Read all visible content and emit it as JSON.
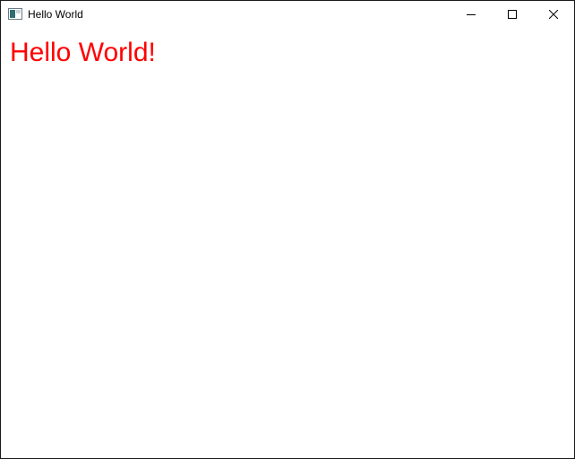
{
  "window": {
    "title": "Hello World",
    "icon": "app-window-icon",
    "controls": {
      "minimize_icon": "minimize-icon",
      "maximize_icon": "maximize-icon",
      "close_icon": "close-icon"
    }
  },
  "content": {
    "greeting": "Hello World!",
    "greeting_color": "#ff0000"
  }
}
